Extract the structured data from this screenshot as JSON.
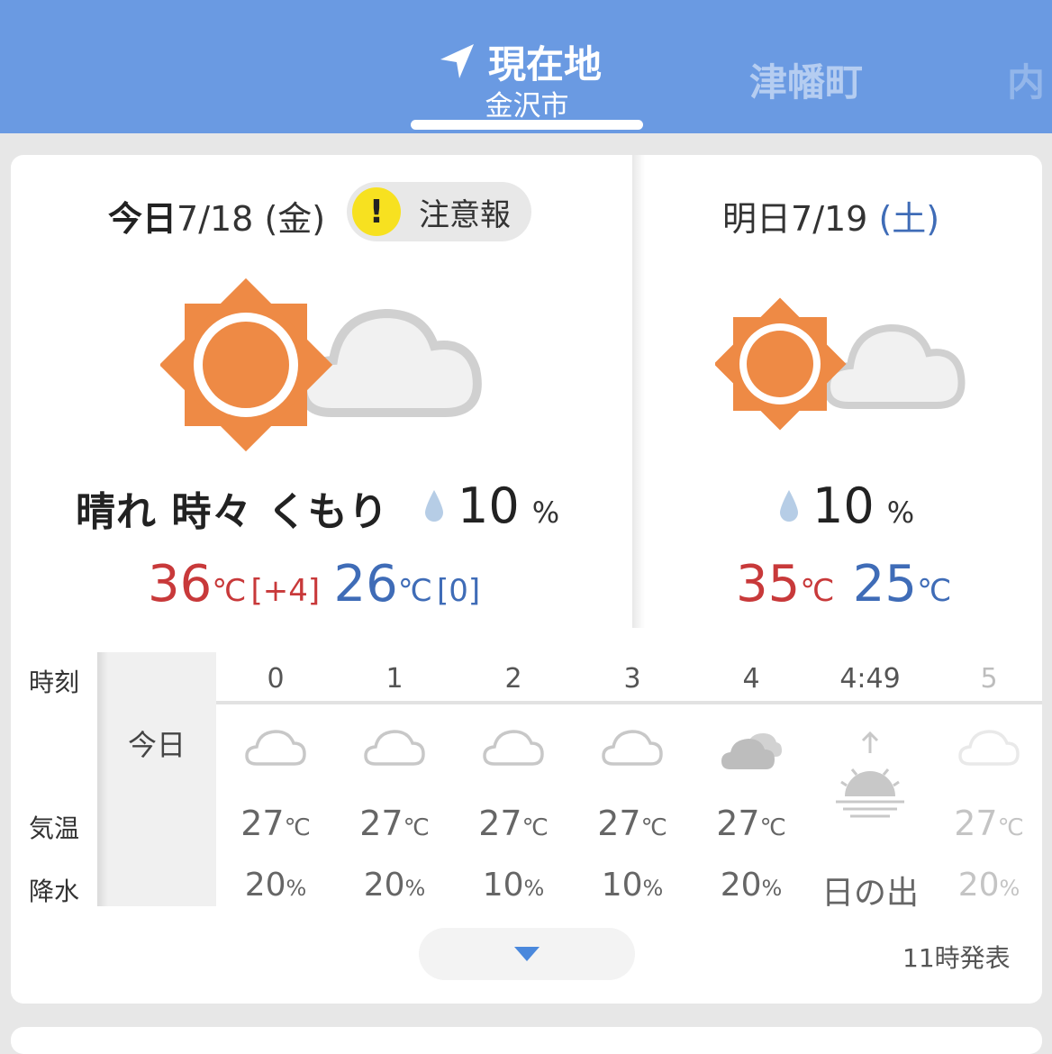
{
  "header": {
    "current_tab": {
      "title": "現在地",
      "subtitle": "金沢市",
      "icon": "location-arrow-icon"
    },
    "other_tabs": [
      "津幡町",
      "内"
    ],
    "colors": {
      "bar": "#6a9ae2"
    }
  },
  "today": {
    "label": "今日",
    "date": "7/18",
    "weekday": "(金)",
    "alert": {
      "mark": "!",
      "text": "注意報"
    },
    "condition": "晴れ 時々 くもり",
    "weather_icon": "sun-cloud-icon",
    "rain_icon": "raindrop-icon",
    "rain_chance": "10",
    "rain_unit": "%",
    "high": "36",
    "high_unit": "℃",
    "high_diff": "[+4]",
    "low": "26",
    "low_unit": "℃",
    "low_diff": "[0]"
  },
  "tomorrow": {
    "label": "明日",
    "date": "7/19",
    "weekday": "(土)",
    "weather_icon": "sun-cloud-icon",
    "rain_icon": "raindrop-icon",
    "rain_chance": "10",
    "rain_unit": "%",
    "high": "35",
    "high_unit": "℃",
    "low": "25",
    "low_unit": "℃"
  },
  "hourly": {
    "row_labels": {
      "time": "時刻",
      "temp": "気温",
      "precip": "降水"
    },
    "day_label": "今日",
    "hours": [
      {
        "time": "0",
        "icon": "cloud-icon",
        "temp": "27",
        "temp_unit": "℃",
        "precip": "20",
        "precip_unit": "%"
      },
      {
        "time": "1",
        "icon": "cloud-icon",
        "temp": "27",
        "temp_unit": "℃",
        "precip": "20",
        "precip_unit": "%"
      },
      {
        "time": "2",
        "icon": "cloud-icon",
        "temp": "27",
        "temp_unit": "℃",
        "precip": "10",
        "precip_unit": "%"
      },
      {
        "time": "3",
        "icon": "cloud-icon",
        "temp": "27",
        "temp_unit": "℃",
        "precip": "10",
        "precip_unit": "%"
      },
      {
        "time": "4",
        "icon": "heavy-cloud-icon",
        "temp": "27",
        "temp_unit": "℃",
        "precip": "20",
        "precip_unit": "%"
      },
      {
        "time": "4:49",
        "icon": "sunrise-icon",
        "temp": "",
        "temp_unit": "",
        "precip": "日の出",
        "precip_unit": ""
      },
      {
        "time": "5",
        "icon": "cloud-icon",
        "temp": "27",
        "temp_unit": "℃",
        "precip": "20",
        "precip_unit": "%"
      }
    ]
  },
  "expand_button": {
    "icon": "chevron-down-icon"
  },
  "issued": "11時発表",
  "colors": {
    "high": "#c8393a",
    "low": "#3f6cb7",
    "sun": "#ee8a45",
    "alert": "#f7e120"
  }
}
